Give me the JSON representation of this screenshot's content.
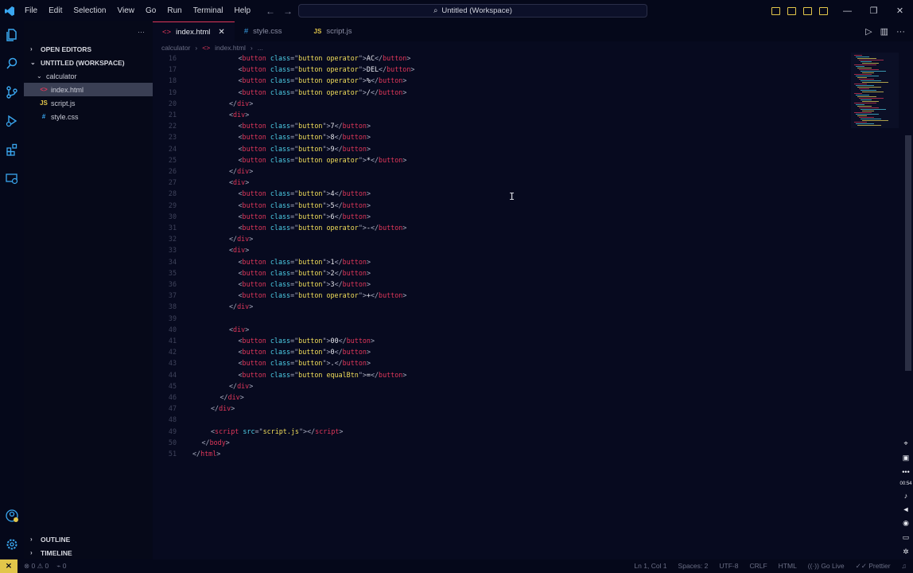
{
  "titlebar": {
    "menu": [
      "File",
      "Edit",
      "Selection",
      "View",
      "Go",
      "Run",
      "Terminal",
      "Help"
    ],
    "search": "Untitled (Workspace)"
  },
  "sidebar": {
    "open_editors": "OPEN EDITORS",
    "workspace": "UNTITLED (WORKSPACE)",
    "folder": "calculator",
    "files": [
      {
        "name": "index.html",
        "icon": "<>"
      },
      {
        "name": "script.js",
        "icon": "JS"
      },
      {
        "name": "style.css",
        "icon": "#"
      }
    ],
    "outline": "OUTLINE",
    "timeline": "TIMELINE"
  },
  "tabs": [
    {
      "label": "index.html",
      "icon": "<>"
    },
    {
      "label": "style.css",
      "icon": "#"
    },
    {
      "label": "script.js",
      "icon": "JS"
    }
  ],
  "breadcrumb": {
    "folder": "calculator",
    "file": "index.html",
    "rest": "..."
  },
  "code_lines": [
    {
      "n": "16",
      "indent": 10,
      "tokens": [
        [
          "t-punc",
          "<"
        ],
        [
          "t-tag",
          "button"
        ],
        [
          "t-text",
          " "
        ],
        [
          "t-attr",
          "class"
        ],
        [
          "t-punc",
          "=\""
        ],
        [
          "t-str",
          "button operator"
        ],
        [
          "t-punc",
          "\">"
        ],
        [
          "t-text",
          "AC"
        ],
        [
          "t-punc",
          "</"
        ],
        [
          "t-tag",
          "button"
        ],
        [
          "t-punc",
          ">"
        ]
      ]
    },
    {
      "n": "17",
      "indent": 10,
      "tokens": [
        [
          "t-punc",
          "<"
        ],
        [
          "t-tag",
          "button"
        ],
        [
          "t-text",
          " "
        ],
        [
          "t-attr",
          "class"
        ],
        [
          "t-punc",
          "=\""
        ],
        [
          "t-str",
          "button operator"
        ],
        [
          "t-punc",
          "\">"
        ],
        [
          "t-text",
          "DEL"
        ],
        [
          "t-punc",
          "</"
        ],
        [
          "t-tag",
          "button"
        ],
        [
          "t-punc",
          ">"
        ]
      ]
    },
    {
      "n": "18",
      "indent": 10,
      "tokens": [
        [
          "t-punc",
          "<"
        ],
        [
          "t-tag",
          "button"
        ],
        [
          "t-text",
          " "
        ],
        [
          "t-attr",
          "class"
        ],
        [
          "t-punc",
          "=\""
        ],
        [
          "t-str",
          "button operator"
        ],
        [
          "t-punc",
          "\">"
        ],
        [
          "t-text",
          "%"
        ],
        [
          "t-punc",
          "</"
        ],
        [
          "t-tag",
          "button"
        ],
        [
          "t-punc",
          ">"
        ]
      ]
    },
    {
      "n": "19",
      "indent": 10,
      "tokens": [
        [
          "t-punc",
          "<"
        ],
        [
          "t-tag",
          "button"
        ],
        [
          "t-text",
          " "
        ],
        [
          "t-attr",
          "class"
        ],
        [
          "t-punc",
          "=\""
        ],
        [
          "t-str",
          "button operator"
        ],
        [
          "t-punc",
          "\">"
        ],
        [
          "t-text",
          "/"
        ],
        [
          "t-punc",
          "</"
        ],
        [
          "t-tag",
          "button"
        ],
        [
          "t-punc",
          ">"
        ]
      ]
    },
    {
      "n": "20",
      "indent": 8,
      "tokens": [
        [
          "t-punc",
          "</"
        ],
        [
          "t-tag",
          "div"
        ],
        [
          "t-punc",
          ">"
        ]
      ]
    },
    {
      "n": "21",
      "indent": 8,
      "tokens": [
        [
          "t-punc",
          "<"
        ],
        [
          "t-tag",
          "div"
        ],
        [
          "t-punc",
          ">"
        ]
      ]
    },
    {
      "n": "22",
      "indent": 10,
      "tokens": [
        [
          "t-punc",
          "<"
        ],
        [
          "t-tag",
          "button"
        ],
        [
          "t-text",
          " "
        ],
        [
          "t-attr",
          "class"
        ],
        [
          "t-punc",
          "=\""
        ],
        [
          "t-str",
          "button"
        ],
        [
          "t-punc",
          "\">"
        ],
        [
          "t-text",
          "7"
        ],
        [
          "t-punc",
          "</"
        ],
        [
          "t-tag",
          "button"
        ],
        [
          "t-punc",
          ">"
        ]
      ]
    },
    {
      "n": "23",
      "indent": 10,
      "tokens": [
        [
          "t-punc",
          "<"
        ],
        [
          "t-tag",
          "button"
        ],
        [
          "t-text",
          " "
        ],
        [
          "t-attr",
          "class"
        ],
        [
          "t-punc",
          "=\""
        ],
        [
          "t-str",
          "button"
        ],
        [
          "t-punc",
          "\">"
        ],
        [
          "t-text",
          "8"
        ],
        [
          "t-punc",
          "</"
        ],
        [
          "t-tag",
          "button"
        ],
        [
          "t-punc",
          ">"
        ]
      ]
    },
    {
      "n": "24",
      "indent": 10,
      "tokens": [
        [
          "t-punc",
          "<"
        ],
        [
          "t-tag",
          "button"
        ],
        [
          "t-text",
          " "
        ],
        [
          "t-attr",
          "class"
        ],
        [
          "t-punc",
          "=\""
        ],
        [
          "t-str",
          "button"
        ],
        [
          "t-punc",
          "\">"
        ],
        [
          "t-text",
          "9"
        ],
        [
          "t-punc",
          "</"
        ],
        [
          "t-tag",
          "button"
        ],
        [
          "t-punc",
          ">"
        ]
      ]
    },
    {
      "n": "25",
      "indent": 10,
      "tokens": [
        [
          "t-punc",
          "<"
        ],
        [
          "t-tag",
          "button"
        ],
        [
          "t-text",
          " "
        ],
        [
          "t-attr",
          "class"
        ],
        [
          "t-punc",
          "=\""
        ],
        [
          "t-str",
          "button operator"
        ],
        [
          "t-punc",
          "\">"
        ],
        [
          "t-text",
          "*"
        ],
        [
          "t-punc",
          "</"
        ],
        [
          "t-tag",
          "button"
        ],
        [
          "t-punc",
          ">"
        ]
      ]
    },
    {
      "n": "26",
      "indent": 8,
      "tokens": [
        [
          "t-punc",
          "</"
        ],
        [
          "t-tag",
          "div"
        ],
        [
          "t-punc",
          ">"
        ]
      ]
    },
    {
      "n": "27",
      "indent": 8,
      "tokens": [
        [
          "t-punc",
          "<"
        ],
        [
          "t-tag",
          "div"
        ],
        [
          "t-punc",
          ">"
        ]
      ]
    },
    {
      "n": "28",
      "indent": 10,
      "tokens": [
        [
          "t-punc",
          "<"
        ],
        [
          "t-tag",
          "button"
        ],
        [
          "t-text",
          " "
        ],
        [
          "t-attr",
          "class"
        ],
        [
          "t-punc",
          "=\""
        ],
        [
          "t-str",
          "button"
        ],
        [
          "t-punc",
          "\">"
        ],
        [
          "t-text",
          "4"
        ],
        [
          "t-punc",
          "</"
        ],
        [
          "t-tag",
          "button"
        ],
        [
          "t-punc",
          ">"
        ]
      ]
    },
    {
      "n": "29",
      "indent": 10,
      "tokens": [
        [
          "t-punc",
          "<"
        ],
        [
          "t-tag",
          "button"
        ],
        [
          "t-text",
          " "
        ],
        [
          "t-attr",
          "class"
        ],
        [
          "t-punc",
          "=\""
        ],
        [
          "t-str",
          "button"
        ],
        [
          "t-punc",
          "\">"
        ],
        [
          "t-text",
          "5"
        ],
        [
          "t-punc",
          "</"
        ],
        [
          "t-tag",
          "button"
        ],
        [
          "t-punc",
          ">"
        ]
      ]
    },
    {
      "n": "30",
      "indent": 10,
      "tokens": [
        [
          "t-punc",
          "<"
        ],
        [
          "t-tag",
          "button"
        ],
        [
          "t-text",
          " "
        ],
        [
          "t-attr",
          "class"
        ],
        [
          "t-punc",
          "=\""
        ],
        [
          "t-str",
          "button"
        ],
        [
          "t-punc",
          "\">"
        ],
        [
          "t-text",
          "6"
        ],
        [
          "t-punc",
          "</"
        ],
        [
          "t-tag",
          "button"
        ],
        [
          "t-punc",
          ">"
        ]
      ]
    },
    {
      "n": "31",
      "indent": 10,
      "tokens": [
        [
          "t-punc",
          "<"
        ],
        [
          "t-tag",
          "button"
        ],
        [
          "t-text",
          " "
        ],
        [
          "t-attr",
          "class"
        ],
        [
          "t-punc",
          "=\""
        ],
        [
          "t-str",
          "button operator"
        ],
        [
          "t-punc",
          "\">"
        ],
        [
          "t-text",
          "-"
        ],
        [
          "t-punc",
          "</"
        ],
        [
          "t-tag",
          "button"
        ],
        [
          "t-punc",
          ">"
        ]
      ]
    },
    {
      "n": "32",
      "indent": 8,
      "tokens": [
        [
          "t-punc",
          "</"
        ],
        [
          "t-tag",
          "div"
        ],
        [
          "t-punc",
          ">"
        ]
      ]
    },
    {
      "n": "33",
      "indent": 8,
      "tokens": [
        [
          "t-punc",
          "<"
        ],
        [
          "t-tag",
          "div"
        ],
        [
          "t-punc",
          ">"
        ]
      ]
    },
    {
      "n": "34",
      "indent": 10,
      "tokens": [
        [
          "t-punc",
          "<"
        ],
        [
          "t-tag",
          "button"
        ],
        [
          "t-text",
          " "
        ],
        [
          "t-attr",
          "class"
        ],
        [
          "t-punc",
          "=\""
        ],
        [
          "t-str",
          "button"
        ],
        [
          "t-punc",
          "\">"
        ],
        [
          "t-text",
          "1"
        ],
        [
          "t-punc",
          "</"
        ],
        [
          "t-tag",
          "button"
        ],
        [
          "t-punc",
          ">"
        ]
      ]
    },
    {
      "n": "35",
      "indent": 10,
      "tokens": [
        [
          "t-punc",
          "<"
        ],
        [
          "t-tag",
          "button"
        ],
        [
          "t-text",
          " "
        ],
        [
          "t-attr",
          "class"
        ],
        [
          "t-punc",
          "=\""
        ],
        [
          "t-str",
          "button"
        ],
        [
          "t-punc",
          "\">"
        ],
        [
          "t-text",
          "2"
        ],
        [
          "t-punc",
          "</"
        ],
        [
          "t-tag",
          "button"
        ],
        [
          "t-punc",
          ">"
        ]
      ]
    },
    {
      "n": "36",
      "indent": 10,
      "tokens": [
        [
          "t-punc",
          "<"
        ],
        [
          "t-tag",
          "button"
        ],
        [
          "t-text",
          " "
        ],
        [
          "t-attr",
          "class"
        ],
        [
          "t-punc",
          "=\""
        ],
        [
          "t-str",
          "button"
        ],
        [
          "t-punc",
          "\">"
        ],
        [
          "t-text",
          "3"
        ],
        [
          "t-punc",
          "</"
        ],
        [
          "t-tag",
          "button"
        ],
        [
          "t-punc",
          ">"
        ]
      ]
    },
    {
      "n": "37",
      "indent": 10,
      "tokens": [
        [
          "t-punc",
          "<"
        ],
        [
          "t-tag",
          "button"
        ],
        [
          "t-text",
          " "
        ],
        [
          "t-attr",
          "class"
        ],
        [
          "t-punc",
          "=\""
        ],
        [
          "t-str",
          "button operator"
        ],
        [
          "t-punc",
          "\">"
        ],
        [
          "t-text",
          "+"
        ],
        [
          "t-punc",
          "</"
        ],
        [
          "t-tag",
          "button"
        ],
        [
          "t-punc",
          ">"
        ]
      ]
    },
    {
      "n": "38",
      "indent": 8,
      "tokens": [
        [
          "t-punc",
          "</"
        ],
        [
          "t-tag",
          "div"
        ],
        [
          "t-punc",
          ">"
        ]
      ]
    },
    {
      "n": "39",
      "indent": 0,
      "tokens": []
    },
    {
      "n": "40",
      "indent": 8,
      "tokens": [
        [
          "t-punc",
          "<"
        ],
        [
          "t-tag",
          "div"
        ],
        [
          "t-punc",
          ">"
        ]
      ]
    },
    {
      "n": "41",
      "indent": 10,
      "tokens": [
        [
          "t-punc",
          "<"
        ],
        [
          "t-tag",
          "button"
        ],
        [
          "t-text",
          " "
        ],
        [
          "t-attr",
          "class"
        ],
        [
          "t-punc",
          "=\""
        ],
        [
          "t-str",
          "button"
        ],
        [
          "t-punc",
          "\">"
        ],
        [
          "t-text",
          "00"
        ],
        [
          "t-punc",
          "</"
        ],
        [
          "t-tag",
          "button"
        ],
        [
          "t-punc",
          ">"
        ]
      ]
    },
    {
      "n": "42",
      "indent": 10,
      "tokens": [
        [
          "t-punc",
          "<"
        ],
        [
          "t-tag",
          "button"
        ],
        [
          "t-text",
          " "
        ],
        [
          "t-attr",
          "class"
        ],
        [
          "t-punc",
          "=\""
        ],
        [
          "t-str",
          "button"
        ],
        [
          "t-punc",
          "\">"
        ],
        [
          "t-text",
          "0"
        ],
        [
          "t-punc",
          "</"
        ],
        [
          "t-tag",
          "button"
        ],
        [
          "t-punc",
          ">"
        ]
      ]
    },
    {
      "n": "43",
      "indent": 10,
      "tokens": [
        [
          "t-punc",
          "<"
        ],
        [
          "t-tag",
          "button"
        ],
        [
          "t-text",
          " "
        ],
        [
          "t-attr",
          "class"
        ],
        [
          "t-punc",
          "=\""
        ],
        [
          "t-str",
          "button"
        ],
        [
          "t-punc",
          "\">"
        ],
        [
          "t-text",
          "."
        ],
        [
          "t-punc",
          "</"
        ],
        [
          "t-tag",
          "button"
        ],
        [
          "t-punc",
          ">"
        ]
      ]
    },
    {
      "n": "44",
      "indent": 10,
      "tokens": [
        [
          "t-punc",
          "<"
        ],
        [
          "t-tag",
          "button"
        ],
        [
          "t-text",
          " "
        ],
        [
          "t-attr",
          "class"
        ],
        [
          "t-punc",
          "=\""
        ],
        [
          "t-str",
          "button equalBtn"
        ],
        [
          "t-punc",
          "\">"
        ],
        [
          "t-text",
          "="
        ],
        [
          "t-punc",
          "</"
        ],
        [
          "t-tag",
          "button"
        ],
        [
          "t-punc",
          ">"
        ]
      ]
    },
    {
      "n": "45",
      "indent": 8,
      "tokens": [
        [
          "t-punc",
          "</"
        ],
        [
          "t-tag",
          "div"
        ],
        [
          "t-punc",
          ">"
        ]
      ]
    },
    {
      "n": "46",
      "indent": 6,
      "tokens": [
        [
          "t-punc",
          "</"
        ],
        [
          "t-tag",
          "div"
        ],
        [
          "t-punc",
          ">"
        ]
      ]
    },
    {
      "n": "47",
      "indent": 4,
      "tokens": [
        [
          "t-punc",
          "</"
        ],
        [
          "t-tag",
          "div"
        ],
        [
          "t-punc",
          ">"
        ]
      ]
    },
    {
      "n": "48",
      "indent": 0,
      "tokens": []
    },
    {
      "n": "49",
      "indent": 4,
      "tokens": [
        [
          "t-punc",
          "<"
        ],
        [
          "t-tag",
          "script"
        ],
        [
          "t-text",
          " "
        ],
        [
          "t-attr",
          "src"
        ],
        [
          "t-punc",
          "=\""
        ],
        [
          "t-str",
          "script.js"
        ],
        [
          "t-punc",
          "\"></"
        ],
        [
          "t-tag",
          "script"
        ],
        [
          "t-punc",
          ">"
        ]
      ]
    },
    {
      "n": "50",
      "indent": 2,
      "tokens": [
        [
          "t-punc",
          "</"
        ],
        [
          "t-tag",
          "body"
        ],
        [
          "t-punc",
          ">"
        ]
      ]
    },
    {
      "n": "51",
      "indent": 0,
      "tokens": [
        [
          "t-punc",
          "</"
        ],
        [
          "t-tag",
          "html"
        ],
        [
          "t-punc",
          ">"
        ]
      ]
    }
  ],
  "statusbar": {
    "errors": "⊗ 0 ⚠ 0",
    "ports": "⌁ 0",
    "position": "Ln 1, Col 1",
    "spaces": "Spaces: 2",
    "encoding": "UTF-8",
    "eol": "CRLF",
    "language": "HTML",
    "golive": "Go Live",
    "prettier": "Prettier"
  },
  "recorder": {
    "time": "00:54"
  },
  "colors": {
    "accent": "#e2c64a",
    "tag": "#e0375a",
    "attr": "#4ed0e8",
    "string": "#f2de5a",
    "background": "#070a1f"
  }
}
